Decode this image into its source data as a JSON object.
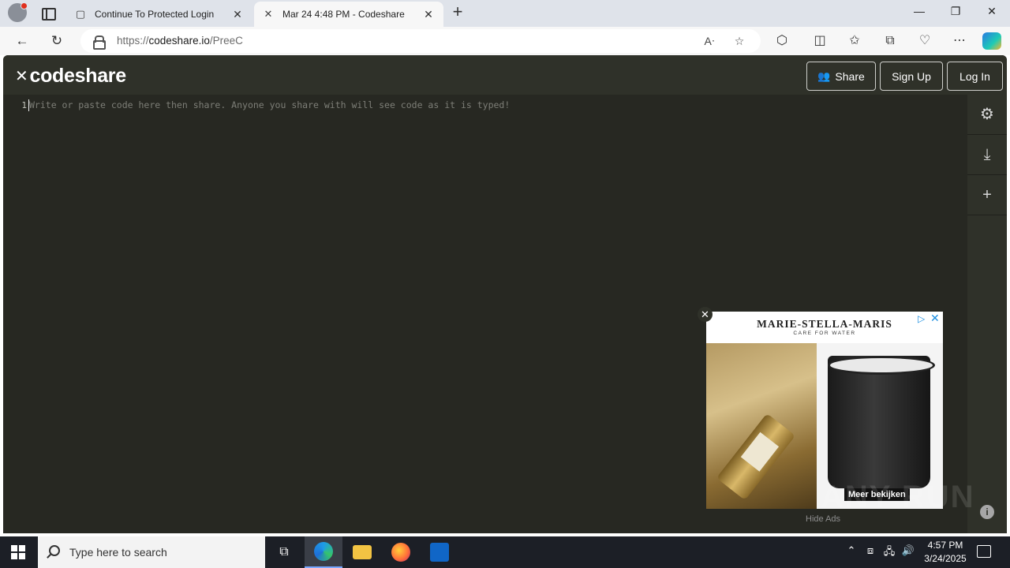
{
  "browser": {
    "tabs": [
      {
        "title": "Continue To Protected Login",
        "icon": "page-icon",
        "active": false
      },
      {
        "title": "Mar 24 4:48 PM - Codeshare",
        "icon": "codeshare-favicon",
        "active": true
      }
    ],
    "url_prefix": "https://",
    "url_host": "codeshare.io",
    "url_path": "/PreeC"
  },
  "codeshare": {
    "logo_mark": "✕",
    "logo_text": "codeshare",
    "share_label": "Share",
    "signup_label": "Sign Up",
    "login_label": "Log In",
    "line_number": "1",
    "placeholder": "Write or paste code here then share. Anyone you share with will see code as it is typed!",
    "hide_ads": "Hide Ads",
    "info_glyph": "i"
  },
  "ad": {
    "brand": "MARIE-STELLA-MARIS",
    "tagline": "CARE FOR WATER",
    "cta": "Meer bekijken"
  },
  "watermark": "ANY RUN",
  "taskbar": {
    "search_placeholder": "Type here to search",
    "time": "4:57 PM",
    "date": "3/24/2025"
  },
  "colors": {
    "editor_bg": "#272822",
    "header_bg": "#2f3129",
    "taskbar_bg": "#1c1f26"
  }
}
